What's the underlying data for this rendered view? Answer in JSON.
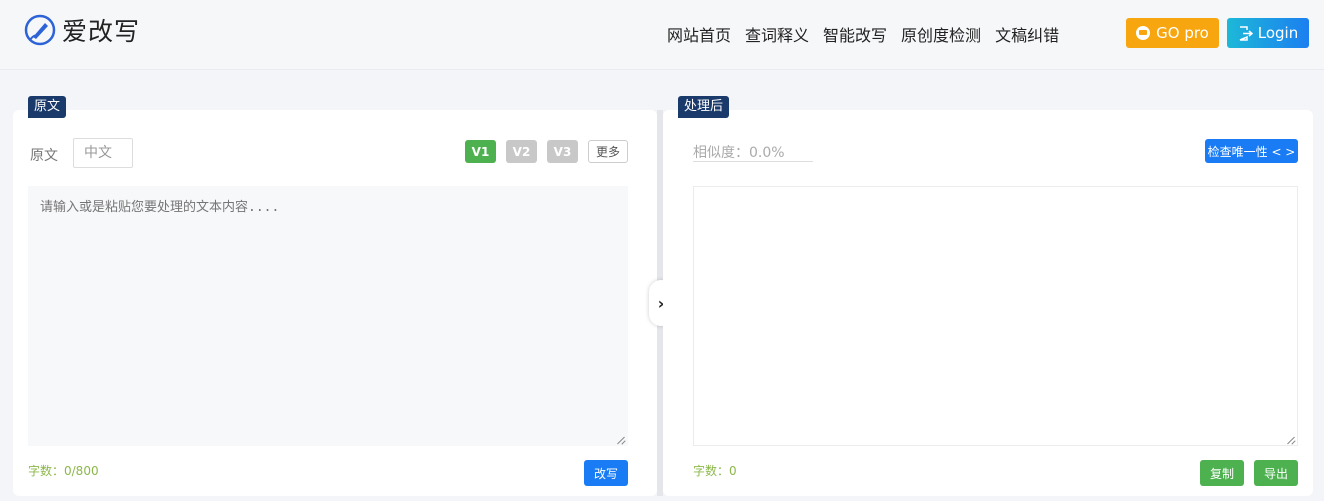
{
  "header": {
    "logo_text": "爱改写",
    "nav": [
      "网站首页",
      "查词释义",
      "智能改写",
      "原创度检测",
      "文稿纠错"
    ],
    "gopro_label": "GO pro",
    "login_label": "Login",
    "colors": {
      "gopro": "#f7a60f",
      "login": "#1c7ff0",
      "tag": "#1a3a6b"
    }
  },
  "left": {
    "tag": "原文",
    "source_label": "原文",
    "lang_value": "中文",
    "versions": [
      "V1",
      "V2",
      "V3"
    ],
    "active_version": "V1",
    "more_label": "更多",
    "placeholder": "请输入或是粘贴您要处理的文本内容....",
    "count": "字数：0/800",
    "rewrite_label": "改写"
  },
  "right": {
    "tag": "处理后",
    "similarity": "相似度：0.0%",
    "check_label": "检查唯一性 < >",
    "count": "字数：0",
    "copy_label": "复制",
    "export_label": "导出"
  },
  "toggle_glyph": "›"
}
